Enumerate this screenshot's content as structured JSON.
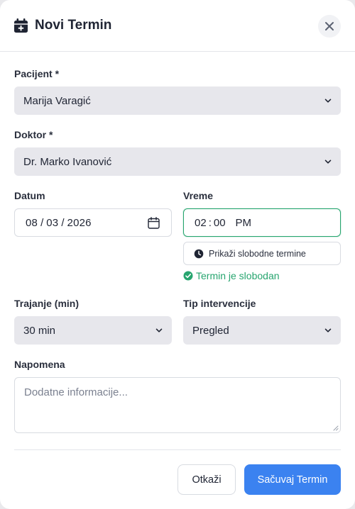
{
  "modal": {
    "title": "Novi Termin"
  },
  "form": {
    "patient": {
      "label": "Pacijent *",
      "value": "Marija Varagić"
    },
    "doctor": {
      "label": "Doktor *",
      "value": "Dr. Marko Ivanović"
    },
    "date": {
      "label": "Datum",
      "month": "08",
      "day": "03",
      "year": "2026",
      "sep": "/"
    },
    "time": {
      "label": "Vreme",
      "hour": "02",
      "minute": "00",
      "sep": ":",
      "period": "PM"
    },
    "free_slots_button": "Prikaži slobodne termine",
    "availability_status": "Termin je slobodan",
    "duration": {
      "label": "Trajanje (min)",
      "value": "30 min"
    },
    "intervention_type": {
      "label": "Tip intervencije",
      "value": "Pregled"
    },
    "note": {
      "label": "Napomena",
      "placeholder": "Dodatne informacije..."
    }
  },
  "actions": {
    "cancel": "Otkaži",
    "save": "Sačuvaj Termin"
  },
  "colors": {
    "accent": "#3b82f0",
    "success": "#27a56f",
    "select_bg": "#e7e7ec"
  },
  "icons": {
    "header": "calendar-plus-icon",
    "close": "close-icon",
    "select": "chevron-down-icon",
    "date": "calendar-icon",
    "free_slots": "clock-icon",
    "status": "check-circle-icon"
  }
}
